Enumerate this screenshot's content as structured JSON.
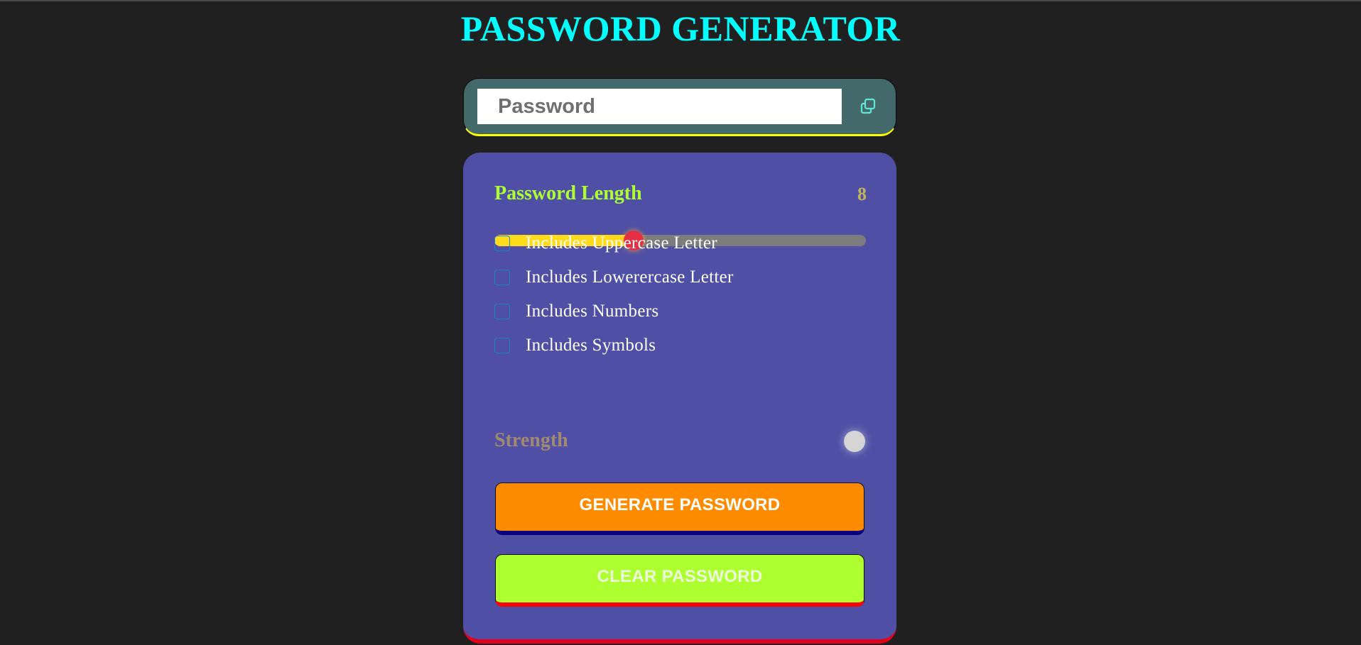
{
  "header": {
    "title": "PASSWORD GENERATOR"
  },
  "display": {
    "placeholder": "Password",
    "value": "",
    "copy_icon": "copy-icon"
  },
  "length": {
    "label": "Password Length",
    "value": "8",
    "slider_fraction": 0.375
  },
  "options": [
    {
      "label": "Includes Uppercase Letter",
      "checked": false
    },
    {
      "label": "Includes Lowerercase Letter",
      "checked": false
    },
    {
      "label": "Includes Numbers",
      "checked": false
    },
    {
      "label": "Includes Symbols",
      "checked": false
    }
  ],
  "strength": {
    "label": "Strength",
    "indicator_color": "#d4d4d4"
  },
  "buttons": {
    "generate_label": "GENERATE PASSWORD",
    "clear_label": "CLEAR PASSWORD"
  },
  "colors": {
    "background": "#202020",
    "title": "#00ffff",
    "panel": "#4f4fa5",
    "display_box": "#44696a",
    "length_label": "#adff2f",
    "length_value": "#c3b45a",
    "slider_fill": "#ffdb1c",
    "slider_track": "#7c7c7c",
    "slider_thumb": "#e52f45",
    "generate_button": "#ff8c00",
    "clear_button": "#adff2f"
  }
}
